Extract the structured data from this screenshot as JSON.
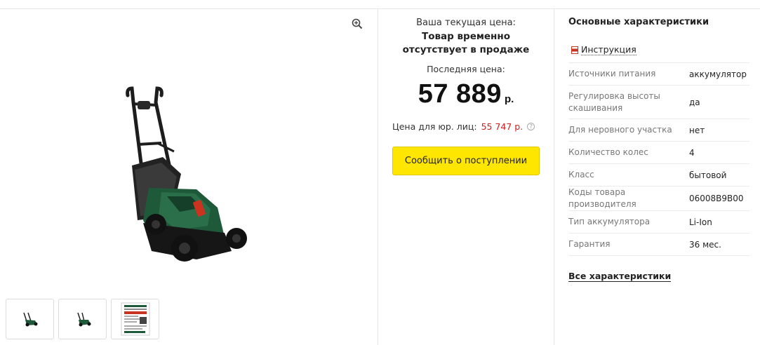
{
  "gallery": {
    "zoom_icon": "zoom-in-icon",
    "main_image": "lawn-mower-photo",
    "thumbnails": [
      "lawn-mower-thumbnail",
      "lawn-mower-thumbnail",
      "product-document-thumbnail"
    ]
  },
  "price": {
    "current_label": "Ваша текущая цена:",
    "status": "Товар временно отсутствует в продаже",
    "last_label": "Последняя цена:",
    "value": "57 889",
    "currency": "р.",
    "legal_label": "Цена для юр. лиц:",
    "legal_value": "55 747 р.",
    "info_icon": "question-circle-icon",
    "notify_button": "Сообщить о поступлении"
  },
  "specs": {
    "title": "Основные характеристики",
    "manual_link": "Инструкция",
    "manual_icon": "pdf-icon",
    "rows": [
      {
        "key": "Источники питания",
        "value": "аккумулятор"
      },
      {
        "key": "Регулировка высоты скашивания",
        "value": "да"
      },
      {
        "key": "Для неровного участка",
        "value": "нет"
      },
      {
        "key": "Количество колес",
        "value": "4"
      },
      {
        "key": "Класс",
        "value": "бытовой"
      },
      {
        "key": "Коды товара производителя",
        "value": "06008B9B00"
      },
      {
        "key": "Тип аккумулятора",
        "value": "Li-Ion"
      },
      {
        "key": "Гарантия",
        "value": "36 мес."
      }
    ],
    "all_link": "Все характеристики"
  },
  "colors": {
    "accent_yellow": "#fee600",
    "legal_price_red": "#d01b1b",
    "mower_green": "#1e5a3a"
  }
}
